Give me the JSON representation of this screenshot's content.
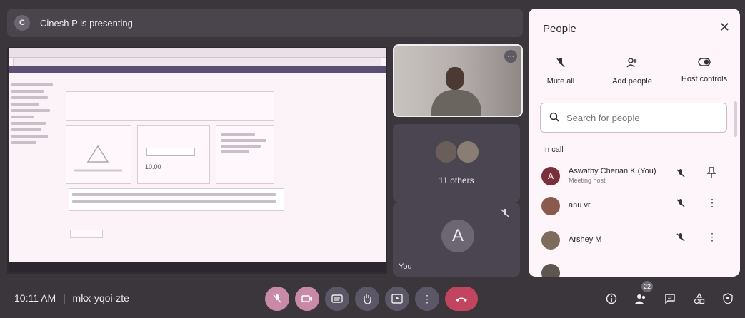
{
  "presenting": {
    "initial": "C",
    "text": "Cinesh P is presenting"
  },
  "tiles": {
    "others_label": "11 others",
    "you_initial": "A",
    "you_label": "You"
  },
  "shared_screen": {
    "amount": "10.00"
  },
  "people_panel": {
    "title": "People",
    "close": "✕",
    "actions": [
      {
        "label": "Mute all",
        "icon": "mic-off-icon"
      },
      {
        "label": "Add people",
        "icon": "add-person-icon"
      },
      {
        "label": "Host controls",
        "icon": "toggle-icon"
      }
    ],
    "search_placeholder": "Search for people",
    "section": "In call",
    "people": [
      {
        "initial": "A",
        "name": "Aswathy Cherian K (You)",
        "sub": "Meeting host",
        "avatar_color": "#7a2f3a"
      },
      {
        "initial": "",
        "name": "anu vr",
        "sub": "",
        "avatar_color": "#8a5a4c"
      },
      {
        "initial": "",
        "name": "Arshey M",
        "sub": "",
        "avatar_color": "#7d6b5e"
      }
    ]
  },
  "bottom_bar": {
    "time": "10:11 AM",
    "separator": "|",
    "meeting_code": "mkx-yqoi-zte",
    "participants_badge": "22"
  }
}
